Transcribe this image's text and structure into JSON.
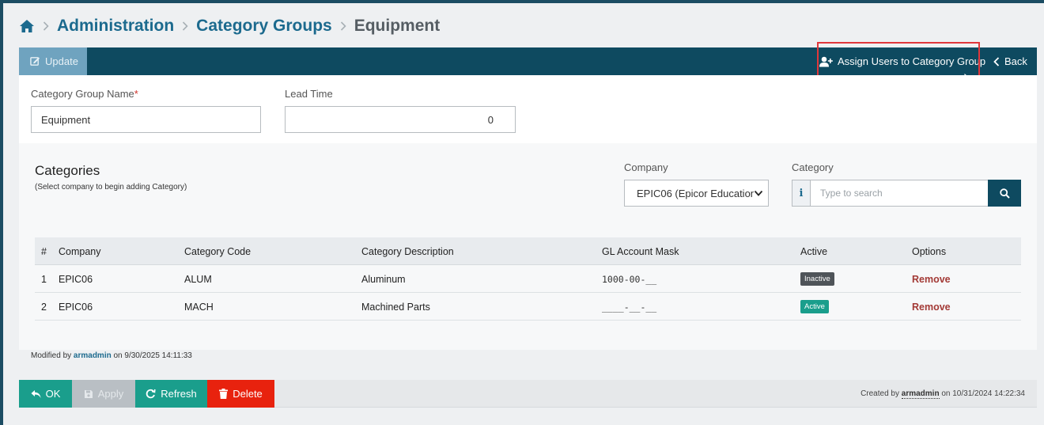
{
  "breadcrumb": {
    "items": [
      "Administration",
      "Category Groups"
    ],
    "current": "Equipment"
  },
  "toolbar": {
    "update_label": "Update",
    "assign_label": "Assign Users to Category Group",
    "back_label": "Back"
  },
  "form": {
    "name_label": "Category Group Name",
    "name_required_mark": "*",
    "name_value": "Equipment",
    "lead_time_label": "Lead Time",
    "lead_time_value": "0"
  },
  "categories": {
    "title": "Categories",
    "subtitle": "(Select company to begin adding Category)",
    "company_label": "Company",
    "company_selected": "EPIC06 (Epicor Education",
    "category_label": "Category",
    "search_placeholder": "Type to search",
    "info_glyph": "i"
  },
  "table": {
    "headers": [
      "#",
      "Company",
      "Category Code",
      "Category Description",
      "GL Account Mask",
      "Active",
      "Options"
    ],
    "rows": [
      {
        "num": "1",
        "company": "EPIC06",
        "code": "ALUM",
        "description": "Aluminum",
        "gl_mask": "1000-00-__",
        "status": "Inactive",
        "option": "Remove"
      },
      {
        "num": "2",
        "company": "EPIC06",
        "code": "MACH",
        "description": "Machined Parts",
        "gl_mask": "____-__-__",
        "status": "Active",
        "option": "Remove"
      }
    ]
  },
  "modified": {
    "prefix": "Modified by",
    "user": "armadmin",
    "suffix": "on 9/30/2025 14:11:33"
  },
  "footer": {
    "ok_label": "OK",
    "apply_label": "Apply",
    "refresh_label": "Refresh",
    "delete_label": "Delete",
    "created_prefix": "Created by",
    "created_user": "armadmin",
    "created_suffix": "on 10/31/2024 14:22:34"
  },
  "colors": {
    "toolbar": "#0e4a60",
    "link": "#1c6a8e",
    "ok": "#1a9e8c",
    "apply_disabled": "#b9bfc4",
    "delete": "#e8220e",
    "highlight": "#e0373b"
  },
  "icons": {
    "home": "home-icon",
    "update": "edit-icon",
    "assign": "user-plus-icon",
    "back": "chevron-left-icon",
    "search": "search-icon",
    "ok": "reply-icon",
    "apply": "save-icon",
    "refresh": "refresh-icon",
    "delete": "trash-icon"
  }
}
